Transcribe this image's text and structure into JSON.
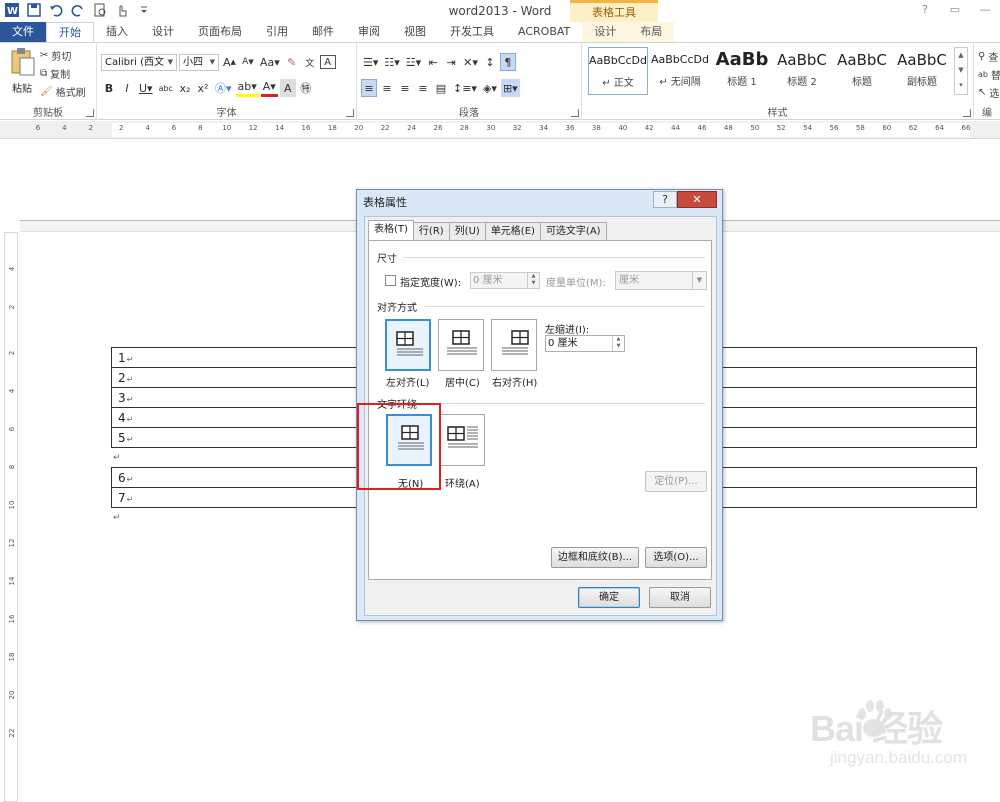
{
  "window": {
    "title": "word2013 - Word",
    "context_label": "表格工具",
    "help": "?"
  },
  "tabs": {
    "file": "文件",
    "items": [
      "开始",
      "插入",
      "设计",
      "页面布局",
      "引用",
      "邮件",
      "审阅",
      "视图",
      "开发工具",
      "ACROBAT"
    ],
    "context_items": [
      "设计",
      "布局"
    ],
    "active": "开始"
  },
  "ribbon": {
    "clipboard": {
      "paste": "粘贴",
      "cut": "剪切",
      "copy": "复制",
      "format_painter": "格式刷",
      "label": "剪贴板"
    },
    "font": {
      "font_name": "Calibri (西文",
      "font_size": "小四",
      "label": "字体"
    },
    "paragraph": {
      "label": "段落"
    },
    "styles": {
      "label": "样式",
      "items": [
        {
          "sample": "AaBbCcDd",
          "name": "↵ 正文"
        },
        {
          "sample": "AaBbCcDd",
          "name": "↵ 无间隔"
        },
        {
          "sample": "AaBb",
          "name": "标题 1"
        },
        {
          "sample": "AaBbC",
          "name": "标题 2"
        },
        {
          "sample": "AaBbC",
          "name": "标题"
        },
        {
          "sample": "AaBbC",
          "name": "副标题"
        }
      ]
    },
    "editing": {
      "find": "查",
      "replace": "替",
      "select": "选",
      "label": "编"
    }
  },
  "ruler": {
    "ticks": [
      "6",
      "4",
      "2",
      "2",
      "4",
      "6",
      "8",
      "10",
      "12",
      "14",
      "16",
      "18",
      "20",
      "22",
      "24",
      "26",
      "28",
      "30",
      "32",
      "34",
      "36",
      "38",
      "40",
      "42",
      "44",
      "46",
      "48",
      "50",
      "52",
      "54",
      "56",
      "58",
      "60",
      "62",
      "64",
      "66"
    ],
    "vticks": [
      "4",
      "2",
      "2",
      "4",
      "6",
      "8",
      "10",
      "12",
      "14",
      "16",
      "18",
      "20",
      "22"
    ]
  },
  "document": {
    "table1_rows": [
      "1",
      "2",
      "3",
      "4",
      "5"
    ],
    "table2_rows": [
      "6",
      "7"
    ],
    "paragraph_mark": "↵"
  },
  "dialog": {
    "title": "表格属性",
    "help_button": "?",
    "close_button": "✕",
    "tabs": [
      "表格(T)",
      "行(R)",
      "列(U)",
      "单元格(E)",
      "可选文字(A)"
    ],
    "active_tab": "表格(T)",
    "size_section": "尺寸",
    "specify_width_label": "指定宽度(W):",
    "specify_width_checked": false,
    "width_value": "0 厘米",
    "measure_label": "度量单位(M):",
    "measure_value": "厘米",
    "alignment_section": "对齐方式",
    "align_options": [
      "左对齐(L)",
      "居中(C)",
      "右对齐(H)"
    ],
    "selected_align": "左对齐(L)",
    "indent_label": "左缩进(I):",
    "indent_value": "0 厘米",
    "wrap_section": "文字环绕",
    "wrap_options": [
      "无(N)",
      "环绕(A)"
    ],
    "selected_wrap": "无(N)",
    "positioning_button": "定位(P)...",
    "borders_button": "边框和底纹(B)...",
    "options_button": "选项(O)...",
    "ok_button": "确定",
    "cancel_button": "取消"
  },
  "watermark": {
    "text": "Bai 经验",
    "sub": "jingyan.baidu.com"
  },
  "colors": {
    "accent": "#2b579a",
    "highlight_box": "#e02020",
    "selected_option": "#3b8ed6"
  }
}
